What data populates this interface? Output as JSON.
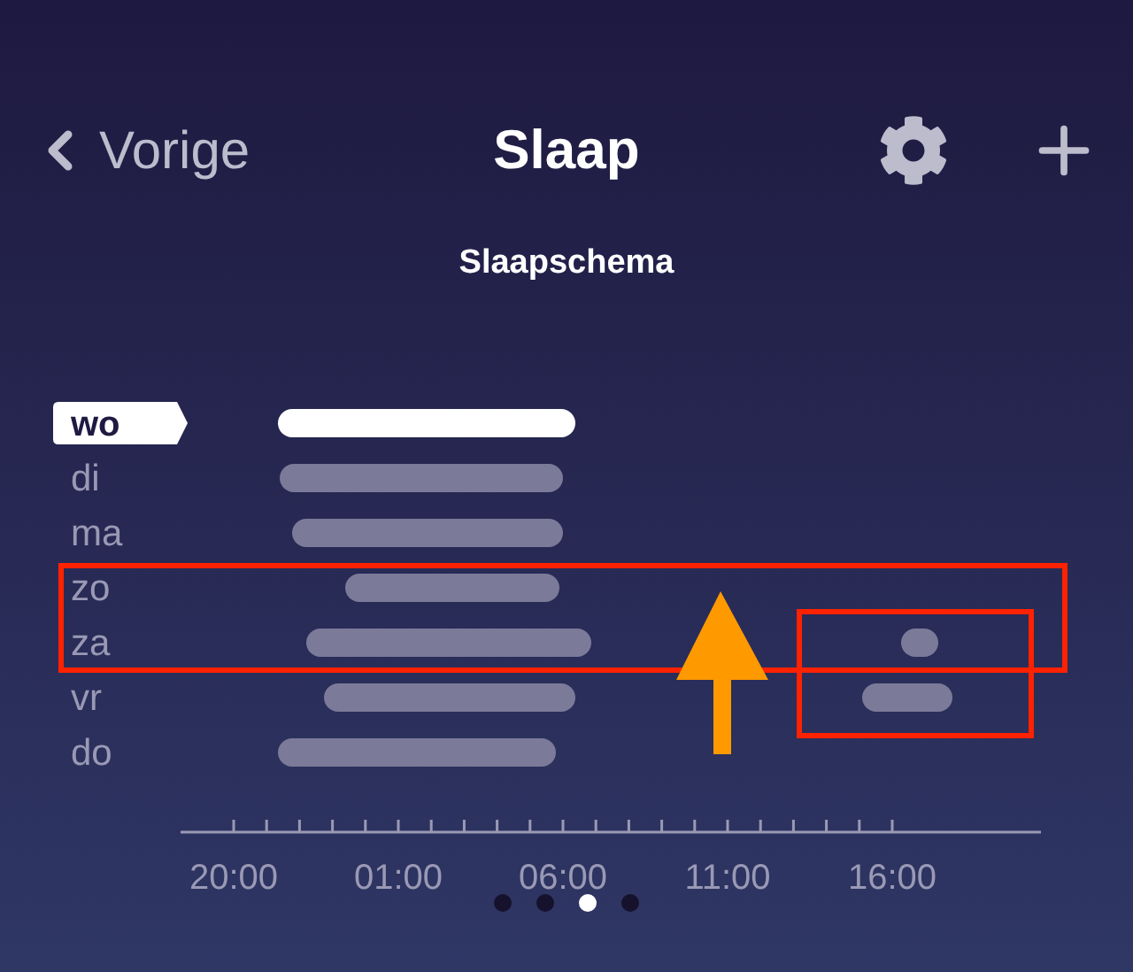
{
  "header": {
    "back_label": "Vorige",
    "title": "Slaap"
  },
  "subtitle": "Slaapschema",
  "days": [
    {
      "label": "wo",
      "selected": true
    },
    {
      "label": "di",
      "selected": false
    },
    {
      "label": "ma",
      "selected": false
    },
    {
      "label": "zo",
      "selected": false
    },
    {
      "label": "za",
      "selected": false
    },
    {
      "label": "vr",
      "selected": false
    },
    {
      "label": "do",
      "selected": false
    }
  ],
  "time_labels": [
    "20:00",
    "01:00",
    "06:00",
    "11:00",
    "16:00"
  ],
  "pages": [
    {
      "selected": false
    },
    {
      "selected": false
    },
    {
      "selected": true
    },
    {
      "selected": false
    }
  ]
}
